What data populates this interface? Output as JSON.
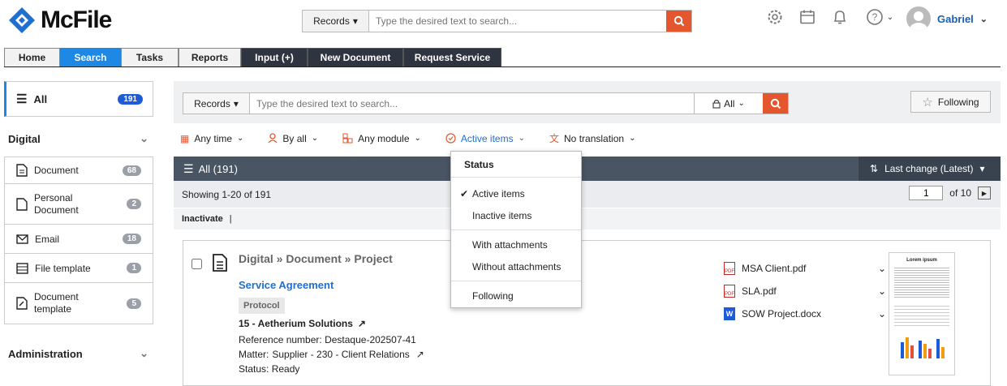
{
  "app": {
    "name": "McFile"
  },
  "top_search": {
    "scope": "Records",
    "placeholder": "Type the desired text to search..."
  },
  "user": {
    "name": "Gabriel"
  },
  "nav": [
    "Home",
    "Search",
    "Tasks",
    "Reports",
    "Input (+)",
    "New Document",
    "Request Service"
  ],
  "sidebar": {
    "all_label": "All",
    "all_count": "191",
    "digital_title": "Digital",
    "digital_items": [
      {
        "label": "Document",
        "count": "68",
        "icon": "document-icon"
      },
      {
        "label": "Personal Document",
        "count": "2",
        "icon": "personal-document-icon"
      },
      {
        "label": "Email",
        "count": "18",
        "icon": "email-icon"
      },
      {
        "label": "File template",
        "count": "1",
        "icon": "file-template-icon"
      },
      {
        "label": "Document template",
        "count": "5",
        "icon": "document-template-icon"
      }
    ],
    "admin_title": "Administration"
  },
  "main_search": {
    "scope": "Records",
    "placeholder": "Type the desired text to search...",
    "access": "All",
    "following": "Following"
  },
  "filters": {
    "time": "Any time",
    "by": "By all",
    "module": "Any module",
    "status": "Active items",
    "translation": "No translation"
  },
  "list": {
    "header": "All (191)",
    "sort": "Last change (Latest)",
    "showing": "Showing 1-20 of 191",
    "page": "1",
    "of_pages": "of 10",
    "action": "Inactivate",
    "action_sep": "|"
  },
  "record": {
    "breadcrumb": "Digital » Document » Project",
    "title": "Service Agreement",
    "tag": "Protocol",
    "party": "15 - Aetherium Solutions",
    "ref_label": "Reference number:",
    "ref_value": "Destaque-202507-41",
    "matter_label": "Matter:",
    "matter_value": "Supplier - 230 - Client Relations",
    "status_label": "Status:",
    "status_value": "Ready",
    "attachments": [
      {
        "name": "MSA Client.pdf",
        "type": "pdf"
      },
      {
        "name": "SLA.pdf",
        "type": "pdf"
      },
      {
        "name": "SOW Project.docx",
        "type": "docx"
      }
    ],
    "preview_title": "Lorem ipsum"
  },
  "status_dropdown": {
    "title": "Status",
    "items": [
      "Active items",
      "Inactive items",
      "With attachments",
      "Without attachments",
      "Following"
    ],
    "checked": "Active items"
  },
  "colors": {
    "accent": "#1e88e5",
    "orange": "#e4572e",
    "dark": "#2e3440",
    "link": "#1e6fd0"
  }
}
